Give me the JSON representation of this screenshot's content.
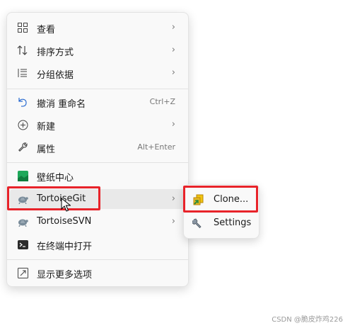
{
  "menu": {
    "items": [
      {
        "label": "查看",
        "icon": "grid-icon",
        "submenu": true
      },
      {
        "label": "排序方式",
        "icon": "sort-icon",
        "submenu": true
      },
      {
        "label": "分组依据",
        "icon": "group-list-icon",
        "submenu": true
      },
      {
        "label": "撤消 重命名",
        "icon": "undo-icon",
        "shortcut": "Ctrl+Z"
      },
      {
        "label": "新建",
        "icon": "plus-circle-icon",
        "submenu": true
      },
      {
        "label": "属性",
        "icon": "wrench-icon",
        "shortcut": "Alt+Enter"
      },
      {
        "label": "壁纸中心",
        "icon": "wallpaper-icon"
      },
      {
        "label": "TortoiseGit",
        "icon": "tortoise-icon",
        "submenu": true,
        "highlighted": true
      },
      {
        "label": "TortoiseSVN",
        "icon": "tortoise-icon",
        "submenu": true
      },
      {
        "label": "在终端中打开",
        "icon": "terminal-icon"
      },
      {
        "label": "显示更多选项",
        "icon": "expand-icon"
      }
    ],
    "chevron": "›"
  },
  "submenu": {
    "items": [
      {
        "label": "Clone...",
        "icon": "git-clone-icon"
      },
      {
        "label": "Settings",
        "icon": "settings-wrench-icon"
      }
    ]
  },
  "highlight_color": "#e8232a",
  "watermark": "CSDN @脆皮炸鸡226"
}
